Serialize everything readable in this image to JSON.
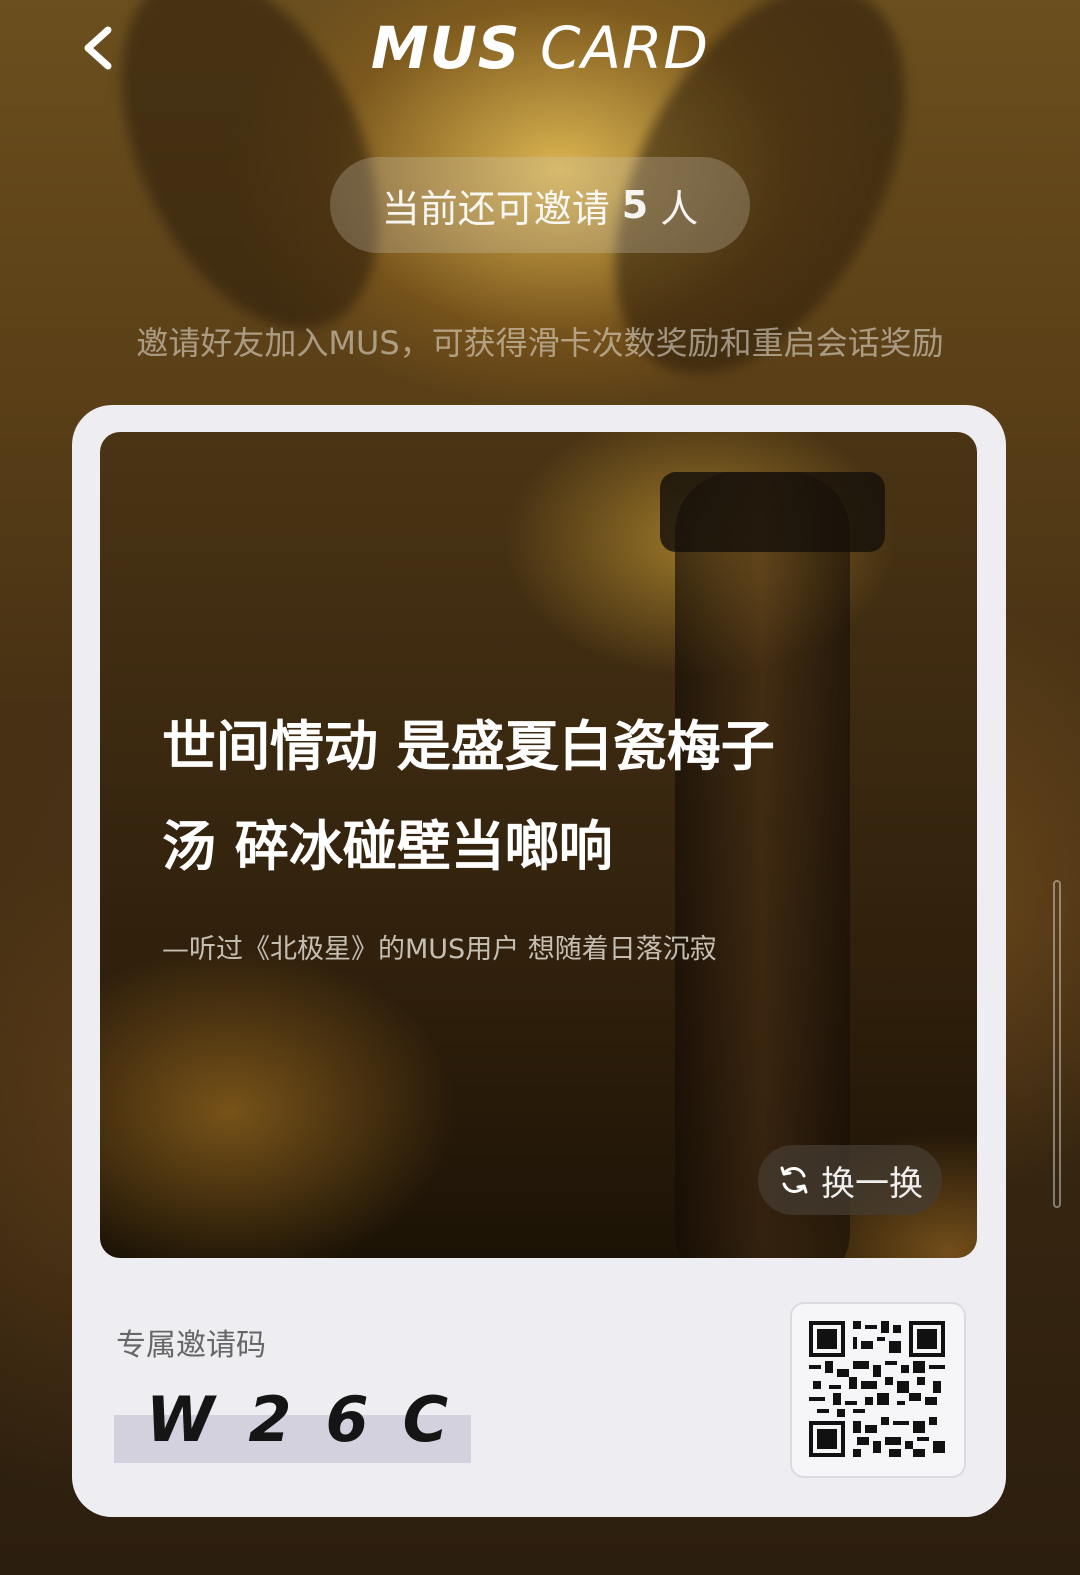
{
  "header": {
    "title_bold": "MUS",
    "title_light": "CARD",
    "back_icon": "chevron-left-icon"
  },
  "invite": {
    "prefix": "当前还可邀请",
    "count": "5",
    "suffix": "人"
  },
  "subtitle": "邀请好友加入MUS，可获得滑卡次数奖励和重启会话奖励",
  "card": {
    "quote_line1": "世间情动 是盛夏白瓷梅子",
    "quote_line2": "汤 碎冰碰壁当啷响",
    "quote_source": "—听过《北极星》的MUS用户 想随着日落沉寂",
    "swap_label": "换一换",
    "swap_icon": "refresh-icon",
    "code_label": "专属邀请码",
    "code_value": "W26C",
    "qr_icon": "qr-code-icon"
  },
  "colors": {
    "card_bg": "#eeeef2",
    "code_highlight": "#d3d1dd",
    "text_white": "#ffffff"
  }
}
